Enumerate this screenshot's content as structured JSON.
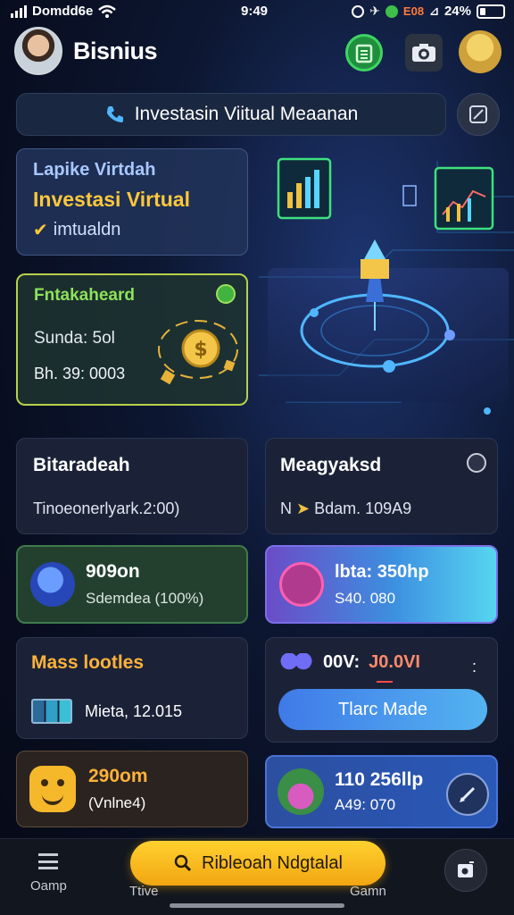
{
  "status_bar": {
    "carrier": "Domdd6e",
    "time": "9:49",
    "net_badge": "E08",
    "battery": "24%"
  },
  "header": {
    "title": "Bisnius"
  },
  "search": {
    "text": "Investasin Viitual Meaanan"
  },
  "promo": {
    "line1": "Lapike Virtdah",
    "line2": "Investasi Virtual",
    "line3": "imtualdn"
  },
  "coin_card": {
    "title": "Fntakaheard",
    "subtitle": "Sunda: 5ol",
    "value": "Bh. 39: 0003"
  },
  "cards": {
    "bitaradeah": {
      "title": "Bitaradeah",
      "subtitle": "Tinoeonerlyark.2:00)"
    },
    "meagaksd": {
      "title": "Meagyaksd",
      "prefix": "N",
      "subtitle": "Bdam. 109A9"
    },
    "c909": {
      "title": "909on",
      "subtitle": "Sdemdea (100%)"
    },
    "ltv": {
      "title": "lbta: 350hp",
      "subtitle": "S40. 080"
    },
    "mass": {
      "title": "Mass lootles",
      "detail": "Mieta, 12.015"
    },
    "v00": {
      "title_a": "00V:",
      "title_b": "J0.0VI",
      "dots": ":",
      "button": "Tlarc Made"
    },
    "c290": {
      "title": "290om",
      "subtitle": "(Vnlne4)"
    },
    "c110": {
      "title": "110 256llp",
      "subtitle": "A49: 070"
    }
  },
  "bottom_nav": {
    "home": "Oamp",
    "trade": "Ttive",
    "game": "Gamn",
    "cta": "Ribleoah Ndgtalal"
  },
  "hero": {
    "coin_symbol": "$"
  },
  "colors": {
    "accent_gold": "#ffc83a",
    "accent_green": "#3fd463",
    "cta_yellow": "#ffd12e",
    "panel_bg": "#1b2237"
  }
}
